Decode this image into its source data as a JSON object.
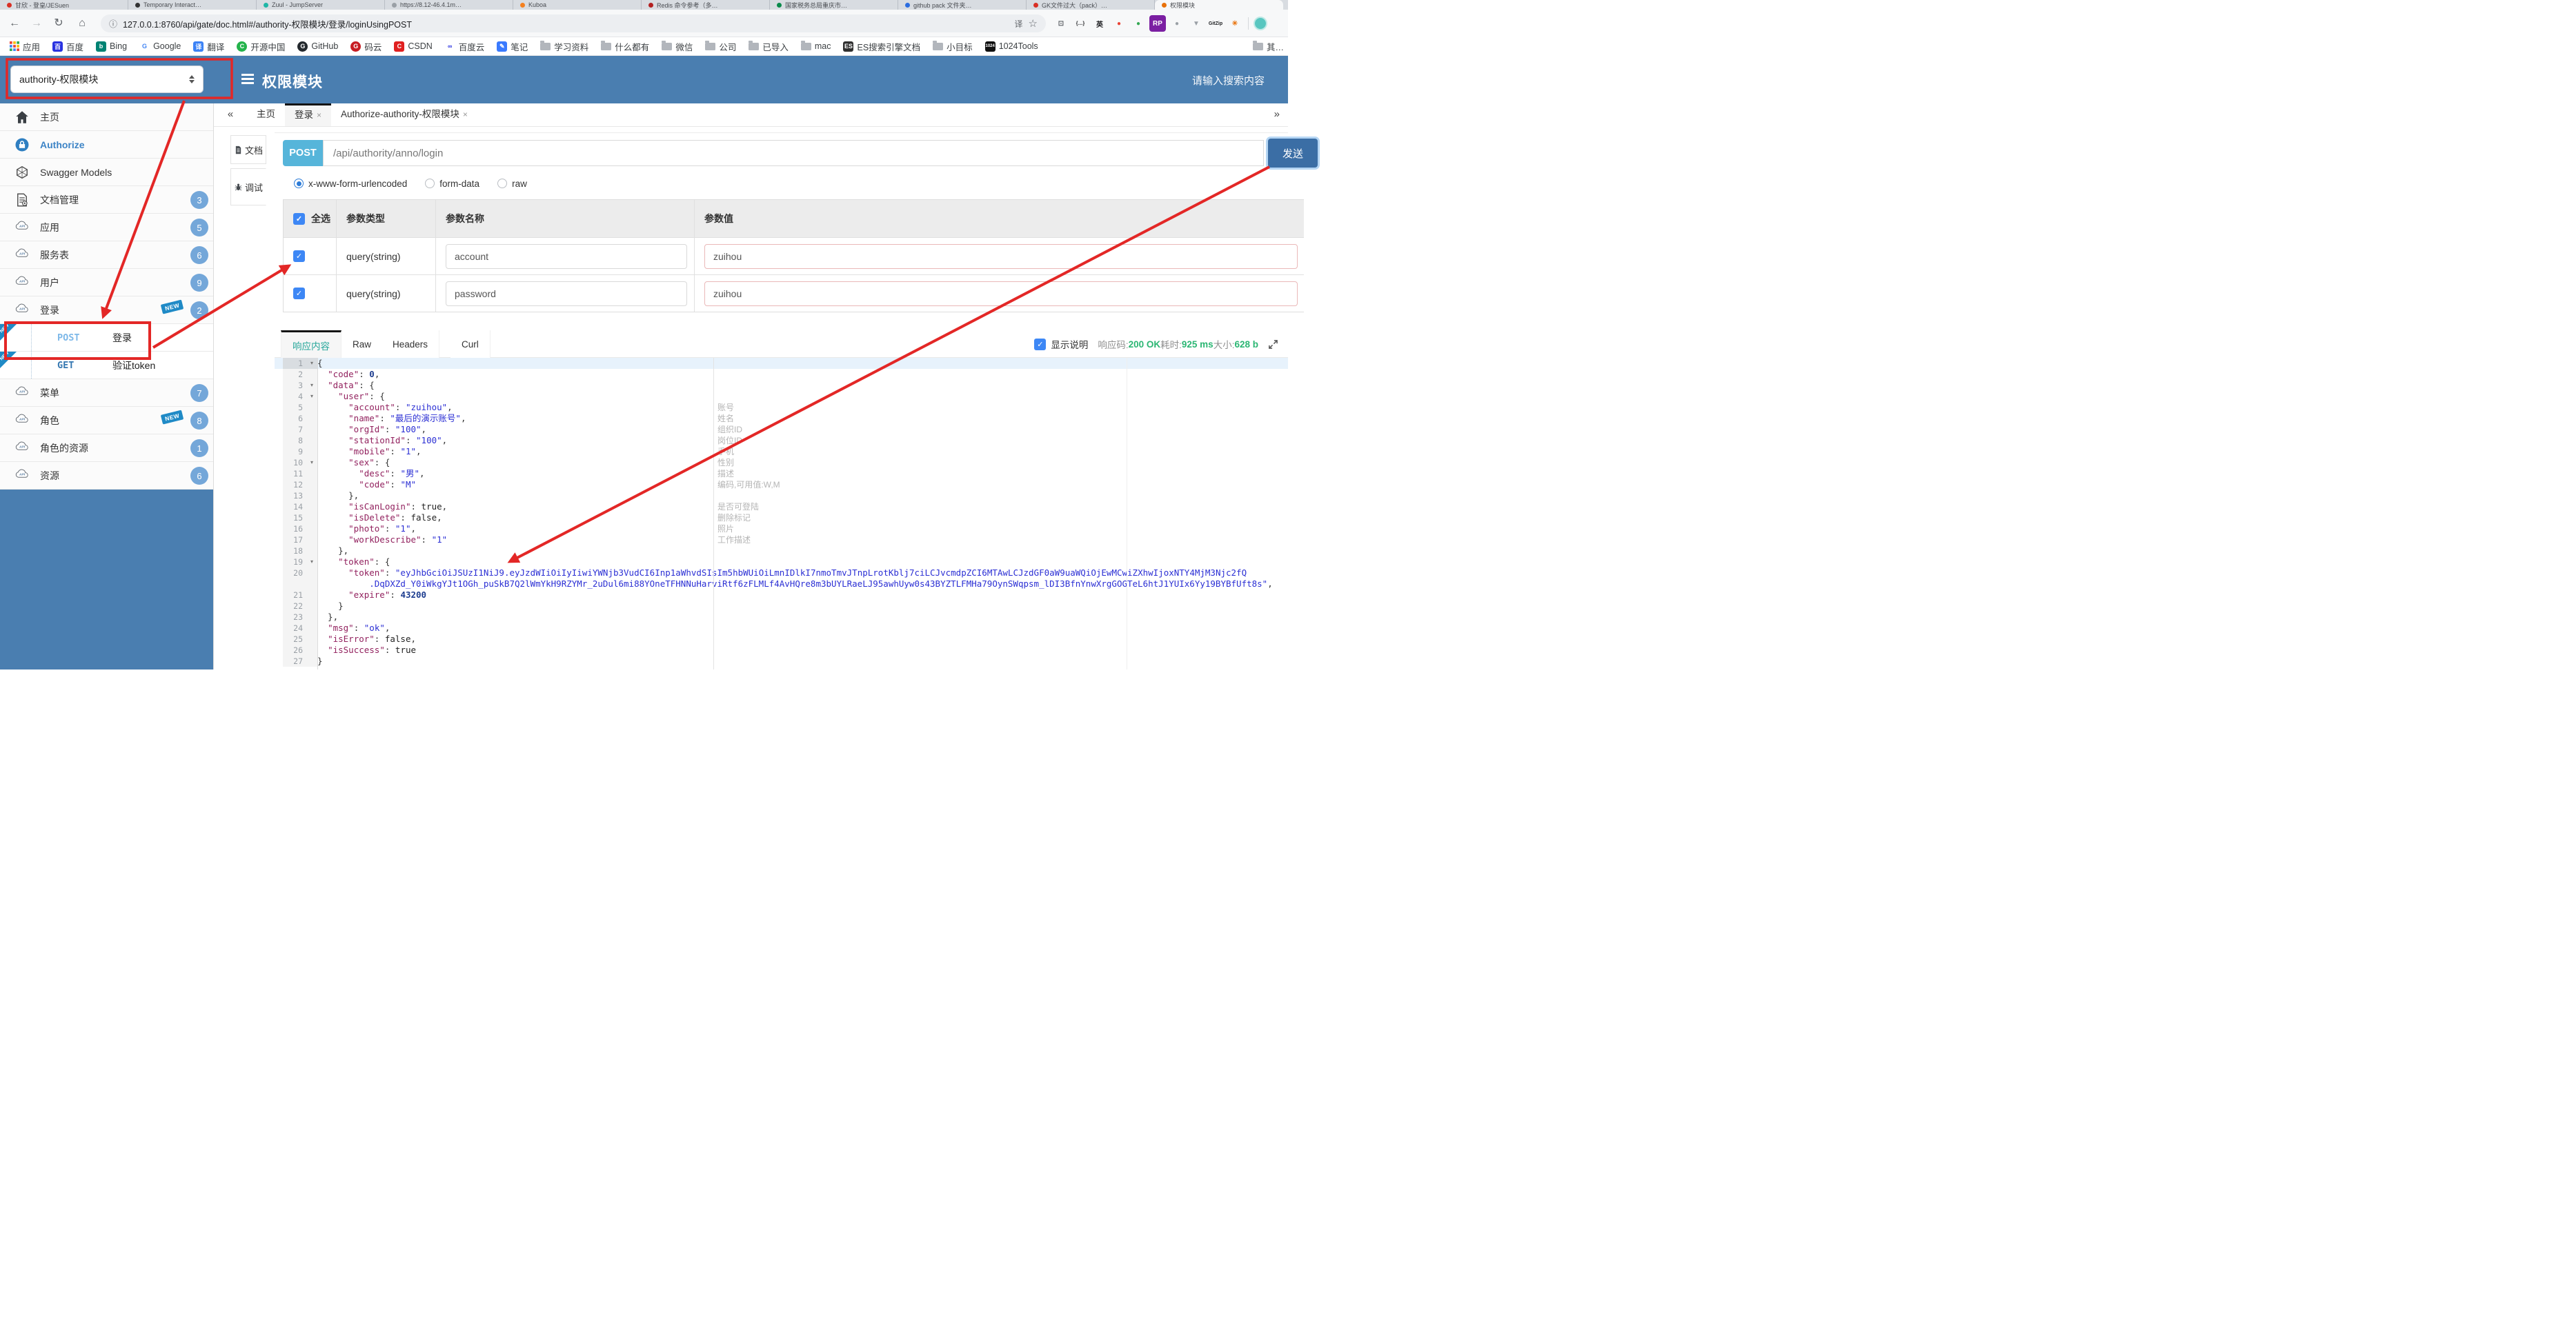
{
  "browser": {
    "tabs": [
      {
        "label": "甘欣 - 登皇/JESuen",
        "color": "#d93025"
      },
      {
        "label": "Temporary Interact…",
        "color": "#333333"
      },
      {
        "label": "Zuul - JumpServer",
        "color": "#1fb6a6"
      },
      {
        "label": "https://8.12-46.4.1m…",
        "color": "#9aa0a6"
      },
      {
        "label": "Kuboa",
        "color": "#f4801f"
      },
      {
        "label": "Redis 命令参考（多…",
        "color": "#b32121"
      },
      {
        "label": "国家税务总局重庆市…",
        "color": "#0a8b4b"
      },
      {
        "label": "github pack 文件夹…",
        "color": "#2b6de0"
      },
      {
        "label": "GK文件过大（pack）…",
        "color": "#d93025"
      },
      {
        "label": "权限模块",
        "color": "#e8710a",
        "active": true
      }
    ],
    "nav": {
      "back": "←",
      "forward": "→",
      "reload": "↻",
      "home": "⌂"
    },
    "url": "127.0.0.1:8760/api/gate/doc.html#/authority-权限模块/登录/loginUsingPOST",
    "info_icon": "ⓘ",
    "translate_icon": "译",
    "star_icon": "☆",
    "extensions": [
      {
        "g": "⊡",
        "fg": "#5f6368",
        "bg": ""
      },
      {
        "g": "{…}",
        "fg": "#202124",
        "bg": ""
      },
      {
        "g": "英",
        "fg": "#202124",
        "bg": ""
      },
      {
        "g": "●",
        "fg": "#ea4335",
        "bg": ""
      },
      {
        "g": "●",
        "fg": "#34a853",
        "bg": ""
      },
      {
        "g": "RP",
        "fg": "#ffffff",
        "bg": "#7b1fa2"
      },
      {
        "g": "●",
        "fg": "#9aa0a6",
        "bg": ""
      },
      {
        "g": "▼",
        "fg": "#9aa0a6",
        "bg": ""
      },
      {
        "g": "GitZip",
        "fg": "#202124",
        "bg": ""
      },
      {
        "g": "✳",
        "fg": "#e8710a",
        "bg": ""
      }
    ],
    "bookmarks": [
      {
        "label": "应用",
        "icon": "apps"
      },
      {
        "label": "百度",
        "g": "百",
        "bg": "#2932e1"
      },
      {
        "label": "Bing",
        "g": "b",
        "bg": "#008373"
      },
      {
        "label": "Google",
        "g": "G",
        "bg": "#ffffff",
        "fg": "#4285f4"
      },
      {
        "label": "翻译",
        "g": "译",
        "bg": "#3b82f6"
      },
      {
        "label": "开源中国",
        "g": "C",
        "bg": "#24b34b",
        "round": true
      },
      {
        "label": "GitHub",
        "g": "G",
        "bg": "#24292e",
        "round": true
      },
      {
        "label": "码云",
        "g": "G",
        "bg": "#c71d23",
        "round": true
      },
      {
        "label": "CSDN",
        "g": "C",
        "bg": "#e02020"
      },
      {
        "label": "百度云",
        "g": "∞",
        "bg": "#ffffff",
        "fg": "#2932e1"
      },
      {
        "label": "笔记",
        "g": "✎",
        "bg": "#3a7afe"
      },
      {
        "label": "学习资料",
        "icon": "folder"
      },
      {
        "label": "什么都有",
        "icon": "folder"
      },
      {
        "label": "微信",
        "icon": "folder"
      },
      {
        "label": "公司",
        "icon": "folder"
      },
      {
        "label": "已导入",
        "icon": "folder"
      },
      {
        "label": "mac",
        "icon": "folder"
      },
      {
        "label": "ES搜索引擎文档",
        "g": "ES",
        "bg": "#303030"
      },
      {
        "label": "小目标",
        "icon": "folder"
      },
      {
        "label": "1024Tools",
        "g": "1024",
        "bg": "#111111"
      }
    ],
    "bookmarks_more": "其…"
  },
  "app": {
    "module_select": "authority-权限模块",
    "title": "权限模块",
    "search_placeholder": "请输入搜索内容"
  },
  "sidebar": {
    "items": [
      {
        "label": "主页",
        "icon": "home"
      },
      {
        "label": "Authorize",
        "icon": "lock",
        "active": true
      },
      {
        "label": "Swagger Models",
        "icon": "models"
      },
      {
        "label": "文档管理",
        "icon": "docs",
        "badge": "3"
      },
      {
        "label": "应用",
        "icon": "api",
        "badge": "5"
      },
      {
        "label": "服务表",
        "icon": "api",
        "badge": "6"
      },
      {
        "label": "用户",
        "icon": "api",
        "badge": "9"
      },
      {
        "label": "登录",
        "icon": "api",
        "badge": "2",
        "isNew": true
      },
      {
        "type": "sub",
        "method": "POST",
        "label": "登录",
        "isNew": true
      },
      {
        "type": "sub",
        "method": "GET",
        "label": "验证token",
        "isNew": true
      },
      {
        "label": "菜单",
        "icon": "api",
        "badge": "7"
      },
      {
        "label": "角色",
        "icon": "api",
        "badge": "8",
        "isNew": true
      },
      {
        "label": "角色的资源",
        "icon": "api",
        "badge": "1"
      },
      {
        "label": "资源",
        "icon": "api",
        "badge": "6"
      }
    ]
  },
  "workspace": {
    "collapse": "«",
    "more": "»",
    "tabs": [
      {
        "label": "主页",
        "closable": false
      },
      {
        "label": "登录",
        "closable": true,
        "active": true
      },
      {
        "label": "Authorize-authority-权限模块",
        "closable": true
      }
    ],
    "doc_tabs": [
      {
        "label": "文档",
        "icon": "doc"
      },
      {
        "label": "调试",
        "icon": "bug",
        "active": true
      }
    ]
  },
  "request": {
    "method": "POST",
    "url": "/api/authority/anno/login",
    "send_label": "发送",
    "content_types": [
      {
        "label": "x-www-form-urlencoded",
        "selected": true
      },
      {
        "label": "form-data",
        "selected": false
      },
      {
        "label": "raw",
        "selected": false
      }
    ]
  },
  "params": {
    "headers": [
      "全选",
      "参数类型",
      "参数名称",
      "参数值"
    ],
    "rows": [
      {
        "checked": true,
        "type": "query(string)",
        "name": "account",
        "value": "zuihou"
      },
      {
        "checked": true,
        "type": "query(string)",
        "name": "password",
        "value": "zuihou"
      }
    ]
  },
  "response": {
    "tabs": [
      "响应内容",
      "Raw",
      "Headers",
      "Curl"
    ],
    "active_tab": "响应内容",
    "show_desc": "显示说明",
    "meta": [
      {
        "label": "响应码:",
        "value": "200 OK"
      },
      {
        "label": "耗时:",
        "value": "925 ms"
      },
      {
        "label": "大小:",
        "value": "628 b"
      }
    ]
  },
  "code": {
    "lines": [
      {
        "n": 1,
        "fold": true,
        "hl": true,
        "segs": [
          [
            "p",
            "{"
          ]
        ]
      },
      {
        "n": 2,
        "segs": [
          [
            "p",
            "  "
          ],
          [
            "k",
            "\"code\""
          ],
          [
            "p",
            ": "
          ],
          [
            "num",
            "0"
          ],
          [
            "p",
            ","
          ]
        ]
      },
      {
        "n": 3,
        "fold": true,
        "segs": [
          [
            "p",
            "  "
          ],
          [
            "k",
            "\"data\""
          ],
          [
            "p",
            ": {"
          ]
        ]
      },
      {
        "n": 4,
        "fold": true,
        "segs": [
          [
            "p",
            "    "
          ],
          [
            "k",
            "\"user\""
          ],
          [
            "p",
            ": {"
          ]
        ]
      },
      {
        "n": 5,
        "segs": [
          [
            "p",
            "      "
          ],
          [
            "k",
            "\"account\""
          ],
          [
            "p",
            ": "
          ],
          [
            "s",
            "\"zuihou\""
          ],
          [
            "p",
            ","
          ]
        ]
      },
      {
        "n": 6,
        "segs": [
          [
            "p",
            "      "
          ],
          [
            "k",
            "\"name\""
          ],
          [
            "p",
            ": "
          ],
          [
            "s",
            "\"最后的演示账号\""
          ],
          [
            "p",
            ","
          ]
        ]
      },
      {
        "n": 7,
        "segs": [
          [
            "p",
            "      "
          ],
          [
            "k",
            "\"orgId\""
          ],
          [
            "p",
            ": "
          ],
          [
            "s",
            "\"100\""
          ],
          [
            "p",
            ","
          ]
        ]
      },
      {
        "n": 8,
        "segs": [
          [
            "p",
            "      "
          ],
          [
            "k",
            "\"stationId\""
          ],
          [
            "p",
            ": "
          ],
          [
            "s",
            "\"100\""
          ],
          [
            "p",
            ","
          ]
        ]
      },
      {
        "n": 9,
        "segs": [
          [
            "p",
            "      "
          ],
          [
            "k",
            "\"mobile\""
          ],
          [
            "p",
            ": "
          ],
          [
            "s",
            "\"1\""
          ],
          [
            "p",
            ","
          ]
        ]
      },
      {
        "n": 10,
        "fold": true,
        "segs": [
          [
            "p",
            "      "
          ],
          [
            "k",
            "\"sex\""
          ],
          [
            "p",
            ": {"
          ]
        ]
      },
      {
        "n": 11,
        "segs": [
          [
            "p",
            "        "
          ],
          [
            "k",
            "\"desc\""
          ],
          [
            "p",
            ": "
          ],
          [
            "s",
            "\"男\""
          ],
          [
            "p",
            ","
          ]
        ]
      },
      {
        "n": 12,
        "segs": [
          [
            "p",
            "        "
          ],
          [
            "k",
            "\"code\""
          ],
          [
            "p",
            ": "
          ],
          [
            "s",
            "\"M\""
          ]
        ]
      },
      {
        "n": 13,
        "segs": [
          [
            "p",
            "      },"
          ]
        ]
      },
      {
        "n": 14,
        "segs": [
          [
            "p",
            "      "
          ],
          [
            "k",
            "\"isCanLogin\""
          ],
          [
            "p",
            ": "
          ],
          [
            "b",
            "true"
          ],
          [
            "p",
            ","
          ]
        ]
      },
      {
        "n": 15,
        "segs": [
          [
            "p",
            "      "
          ],
          [
            "k",
            "\"isDelete\""
          ],
          [
            "p",
            ": "
          ],
          [
            "b",
            "false"
          ],
          [
            "p",
            ","
          ]
        ]
      },
      {
        "n": 16,
        "segs": [
          [
            "p",
            "      "
          ],
          [
            "k",
            "\"photo\""
          ],
          [
            "p",
            ": "
          ],
          [
            "s",
            "\"1\""
          ],
          [
            "p",
            ","
          ]
        ]
      },
      {
        "n": 17,
        "segs": [
          [
            "p",
            "      "
          ],
          [
            "k",
            "\"workDescribe\""
          ],
          [
            "p",
            ": "
          ],
          [
            "s",
            "\"1\""
          ]
        ]
      },
      {
        "n": 18,
        "segs": [
          [
            "p",
            "    },"
          ]
        ]
      },
      {
        "n": 19,
        "fold": true,
        "segs": [
          [
            "p",
            "    "
          ],
          [
            "k",
            "\"token\""
          ],
          [
            "p",
            ": {"
          ]
        ]
      },
      {
        "n": 20,
        "segs": [
          [
            "p",
            "      "
          ],
          [
            "k",
            "\"token\""
          ],
          [
            "p",
            ": "
          ],
          [
            "s",
            "\"eyJhbGciOiJSUzI1NiJ9.eyJzdWIiOiIyIiwiYWNjb3VudCI6Inp1aWhvdSIsIm5hbWUiOiLmnIDlkI7nmoTmvJTnpLrotKblj7ciLCJvcmdpZCI6MTAwLCJzdGF0aW9uaWQiOjEwMCwiZXhwIjoxNTY4MjM3Njc2fQ"
          ]
        ]
      },
      {
        "wrap": true,
        "segs": [
          [
            "s",
            "          .DqDXZd_Y0iWkgYJt1OGh_puSkB7Q2lWmYkH9RZYMr_2uDul6mi88YOneTFHNNuHarviRtf6zFLMLf4AvHQre8m3bUYLRaeLJ95awhUyw0s43BYZTLFMHa79OynSWqpsm_lDI3BfnYnwXrgGOGTeL6htJ1YUIx6Yy19BYBfUft8s\""
          ],
          [
            "p",
            ","
          ]
        ]
      },
      {
        "n": 21,
        "segs": [
          [
            "p",
            "      "
          ],
          [
            "k",
            "\"expire\""
          ],
          [
            "p",
            ": "
          ],
          [
            "num",
            "43200"
          ]
        ]
      },
      {
        "n": 22,
        "segs": [
          [
            "p",
            "    }"
          ]
        ]
      },
      {
        "n": 23,
        "segs": [
          [
            "p",
            "  },"
          ]
        ]
      },
      {
        "n": 24,
        "segs": [
          [
            "p",
            "  "
          ],
          [
            "k",
            "\"msg\""
          ],
          [
            "p",
            ": "
          ],
          [
            "s",
            "\"ok\""
          ],
          [
            "p",
            ","
          ]
        ]
      },
      {
        "n": 25,
        "segs": [
          [
            "p",
            "  "
          ],
          [
            "k",
            "\"isError\""
          ],
          [
            "p",
            ": "
          ],
          [
            "b",
            "false"
          ],
          [
            "p",
            ","
          ]
        ]
      },
      {
        "n": 26,
        "segs": [
          [
            "p",
            "  "
          ],
          [
            "k",
            "\"isSuccess\""
          ],
          [
            "p",
            ": "
          ],
          [
            "b",
            "true"
          ]
        ]
      },
      {
        "n": 27,
        "segs": [
          [
            "p",
            "}"
          ]
        ]
      }
    ],
    "annotations": [
      {
        "row": 5,
        "text": "账号"
      },
      {
        "row": 6,
        "text": "姓名"
      },
      {
        "row": 7,
        "text": "组织ID"
      },
      {
        "row": 8,
        "text": "岗位ID"
      },
      {
        "row": 9,
        "text": "手机"
      },
      {
        "row": 10,
        "text": "性别"
      },
      {
        "row": 11,
        "text": "描述"
      },
      {
        "row": 12,
        "text": "编码,可用值:W,M"
      },
      {
        "row": 14,
        "text": "是否可登陆"
      },
      {
        "row": 15,
        "text": "删除标记"
      },
      {
        "row": 16,
        "text": "照片"
      },
      {
        "row": 17,
        "text": "工作描述"
      }
    ]
  },
  "colors": {
    "header_blue": "#4a7eb0",
    "post_badge": "#56b5da",
    "send_button": "#3b6ea5",
    "annotation_red": "#e32726",
    "status_green": "#2bb673",
    "badge_blue": "#74a7d9"
  }
}
